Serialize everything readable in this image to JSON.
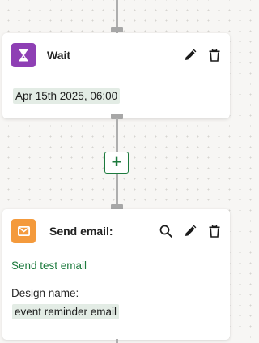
{
  "colors": {
    "wait_icon_bg": "#8e3fb4",
    "email_icon_bg": "#f49a3c",
    "link_green": "#1c7a3d",
    "chip_bg": "#e3ece5",
    "connector": "#aeaeae"
  },
  "wait_step": {
    "title": "Wait",
    "icon": "hourglass-icon",
    "value": "Apr 15th 2025, 06:00",
    "actions": [
      "pencil-icon",
      "trash-icon"
    ]
  },
  "add_step": {
    "label": "+"
  },
  "email_step": {
    "title": "Send email:",
    "icon": "envelope-icon",
    "test_link": "Send test email",
    "design_label": "Design name:",
    "design_value": "event reminder email",
    "actions": [
      "search-icon",
      "pencil-icon",
      "trash-icon"
    ]
  }
}
